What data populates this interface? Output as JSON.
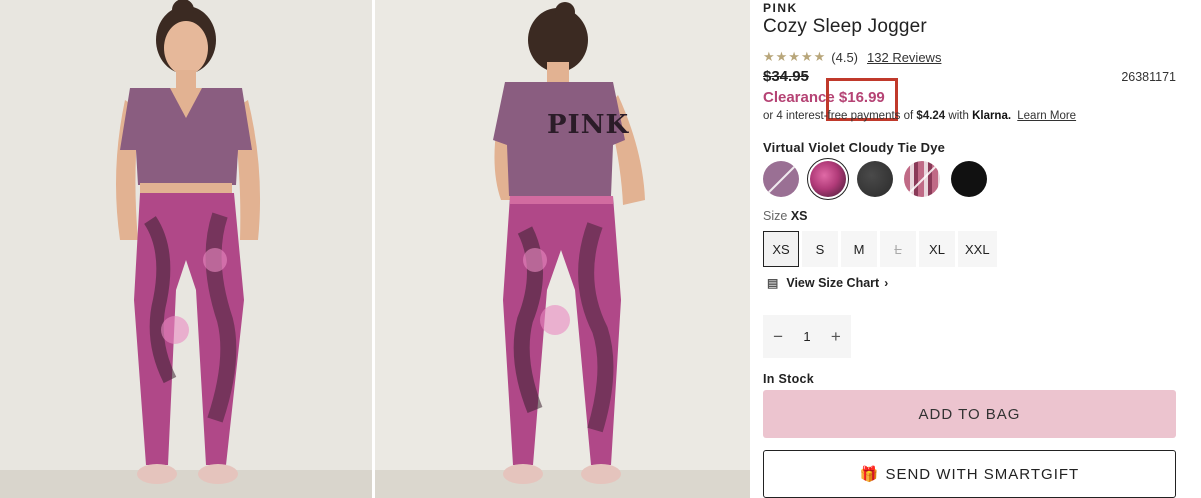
{
  "product": {
    "brand": "PINK",
    "title": "Cozy Sleep Jogger",
    "stars": "★★★★★",
    "rating": "(4.5)",
    "reviews": "132 Reviews",
    "original_price": "$34.95",
    "sku": "26381171",
    "clearance_label": "Clearance",
    "clearance_price": "$16.99",
    "klarna": {
      "prefix": "or 4 interest-free payments of",
      "amount": "$4.24",
      "with": "with",
      "logo": "Klarna.",
      "learn_more": "Learn More"
    },
    "color_name": "Virtual Violet Cloudy Tie Dye",
    "swatches": [
      {
        "name": "violet-solid",
        "color": "#9a7094",
        "selected": false,
        "unavailable": true
      },
      {
        "name": "violet-tie-dye",
        "color": "#c2467f",
        "selected": true,
        "unavailable": false
      },
      {
        "name": "charcoal-heather",
        "color": "#3a3a3a",
        "selected": false,
        "unavailable": false
      },
      {
        "name": "plaid",
        "color": "#b8899a",
        "selected": false,
        "unavailable": true
      },
      {
        "name": "black",
        "color": "#111111",
        "selected": false,
        "unavailable": false
      }
    ],
    "size_label": "Size",
    "selected_size": "XS",
    "sizes": [
      "XS",
      "S",
      "M",
      "L",
      "XL",
      "XXL"
    ],
    "view_size_chart": "View Size Chart",
    "quantity": "1",
    "stock_status": "In Stock",
    "add_to_bag": "ADD TO BAG",
    "send_gift": "SEND WITH SMARTGIFT"
  },
  "photo_back": {
    "shirt_text": "PINK"
  }
}
